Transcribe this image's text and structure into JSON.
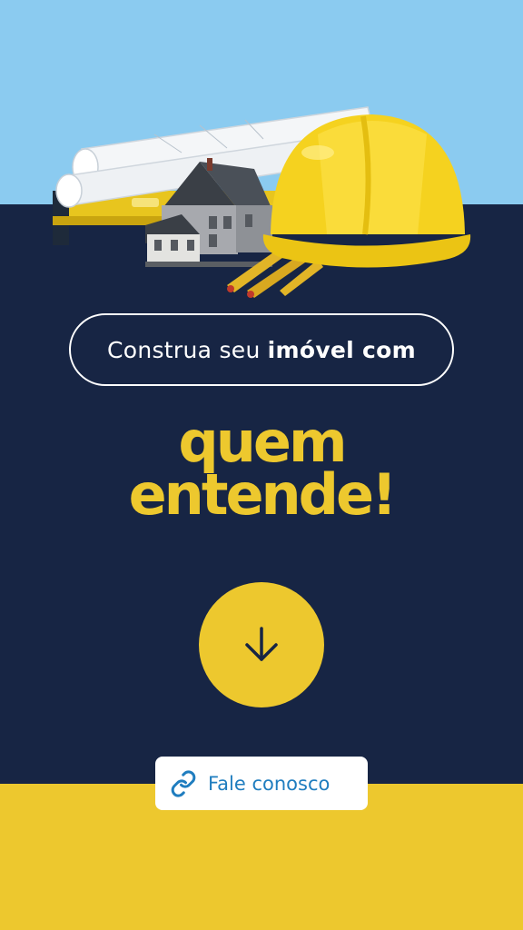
{
  "intro": {
    "text_light": "Construa seu",
    "text_bold": "imóvel com"
  },
  "headline": {
    "line1": "quem",
    "line2": "entende!"
  },
  "scroll_button": {
    "icon": "arrow-down-icon"
  },
  "cta": {
    "label": "Fale conosco",
    "icon": "link-icon"
  },
  "colors": {
    "sky": "#8BCBF0",
    "navy": "#172544",
    "accent_yellow": "#EDC82E",
    "link_blue": "#1F7DBF",
    "white": "#FFFFFF"
  }
}
